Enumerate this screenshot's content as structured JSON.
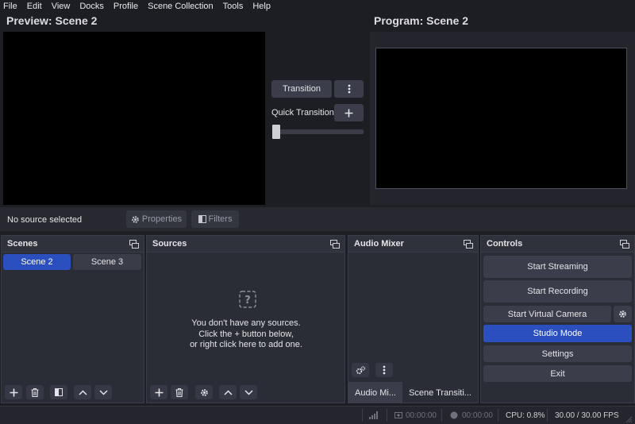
{
  "menu": [
    "File",
    "Edit",
    "View",
    "Docks",
    "Profile",
    "Scene Collection",
    "Tools",
    "Help"
  ],
  "preview": {
    "title": "Preview: Scene 2"
  },
  "program": {
    "title": "Program: Scene 2"
  },
  "transition": {
    "button_label": "Transition",
    "quick_label": "Quick Transitions",
    "tbar_value": 0
  },
  "source_toolbar": {
    "status": "No source selected",
    "properties_label": "Properties",
    "filters_label": "Filters"
  },
  "scenes": {
    "title": "Scenes",
    "items": [
      "Scene 2",
      "Scene 3"
    ],
    "selected": "Scene 2"
  },
  "sources": {
    "title": "Sources",
    "empty_lines": [
      "You don't have any sources.",
      "Click the + button below,",
      "or right click here to add one."
    ]
  },
  "audio_mixer": {
    "title": "Audio Mixer",
    "tabs": [
      "Audio Mi...",
      "Scene Transiti..."
    ]
  },
  "controls": {
    "title": "Controls",
    "start_streaming": "Start Streaming",
    "start_recording": "Start Recording",
    "start_virtual_camera": "Start Virtual Camera",
    "studio_mode": "Studio Mode",
    "settings": "Settings",
    "exit": "Exit"
  },
  "status": {
    "stream_time": "00:00:00",
    "record_time": "00:00:00",
    "cpu": "CPU: 0.8%",
    "fps": "30.00 / 30.00 FPS"
  },
  "colors": {
    "accent": "#2b4fbf",
    "background": "#1d1e24",
    "dock": "#2b2d36"
  }
}
